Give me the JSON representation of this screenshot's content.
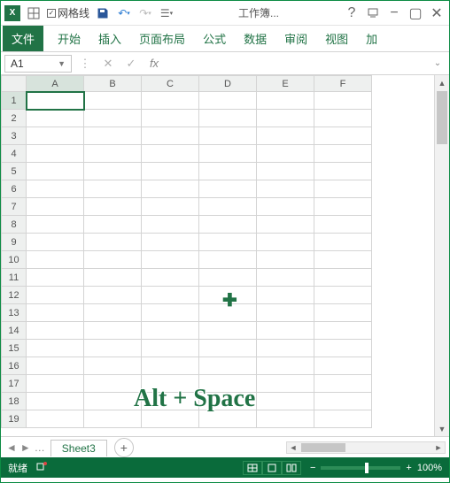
{
  "titlebar": {
    "gridlines_checkbox_label": "网格线",
    "workbook_title": "工作簿...",
    "help_icon": "?"
  },
  "ribbon": {
    "file": "文件",
    "home": "开始",
    "insert": "插入",
    "page_layout": "页面布局",
    "formulas": "公式",
    "data": "数据",
    "review": "审阅",
    "view": "视图",
    "add": "加"
  },
  "formula_bar": {
    "namebox_value": "A1",
    "fx_label": "fx"
  },
  "grid": {
    "columns": [
      "A",
      "B",
      "C",
      "D",
      "E",
      "F"
    ],
    "rows": [
      "1",
      "2",
      "3",
      "4",
      "5",
      "6",
      "7",
      "8",
      "9",
      "10",
      "11",
      "12",
      "13",
      "14",
      "15",
      "16",
      "17",
      "18",
      "19"
    ],
    "selected_cell": "A1"
  },
  "overlay": {
    "shortcut_text": "Alt + Space"
  },
  "sheet_tabs": {
    "active": "Sheet3",
    "add_label": "+"
  },
  "status": {
    "ready": "就绪",
    "zoom_pct": "100%",
    "zoom_minus": "−",
    "zoom_plus": "+"
  },
  "icons": {
    "save": "save-icon",
    "undo": "undo-icon",
    "redo": "redo-icon"
  }
}
